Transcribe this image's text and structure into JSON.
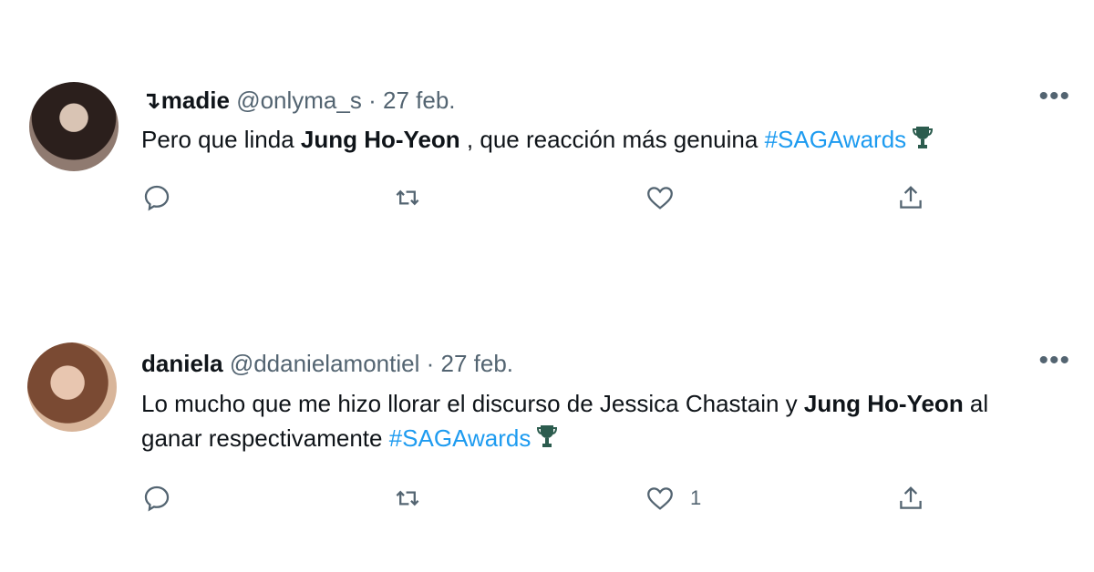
{
  "tweets": [
    {
      "name_prefix": "↴",
      "name": "madie",
      "handle": "@onlyma_s",
      "separator": "·",
      "date": "27 feb.",
      "more_label": "•••",
      "text_parts": {
        "p1": "Pero que linda ",
        "b1": "Jung Ho-Yeon",
        "p2": " , que reacción más genuina ",
        "hashtag": "#SAGAwards"
      },
      "actions": {
        "reply_icon": "reply-icon",
        "retweet_icon": "retweet-icon",
        "like_icon": "like-icon",
        "like_count": "",
        "share_icon": "share-icon"
      }
    },
    {
      "name": "daniela",
      "handle": "@ddanielamontiel",
      "separator": "·",
      "date": "27 feb.",
      "more_label": "•••",
      "text_parts": {
        "p1": "Lo mucho que me hizo llorar el discurso de Jessica Chastain y ",
        "b1": "Jung Ho-Yeon",
        "p2": " al ganar respectivamente ",
        "hashtag": "#SAGAwards"
      },
      "actions": {
        "reply_icon": "reply-icon",
        "retweet_icon": "retweet-icon",
        "like_icon": "like-icon",
        "like_count": "1",
        "share_icon": "share-icon"
      }
    }
  ],
  "colors": {
    "text_primary": "#0f1419",
    "text_secondary": "#536471",
    "hashtag": "#1d9bf0",
    "background": "#ffffff"
  }
}
